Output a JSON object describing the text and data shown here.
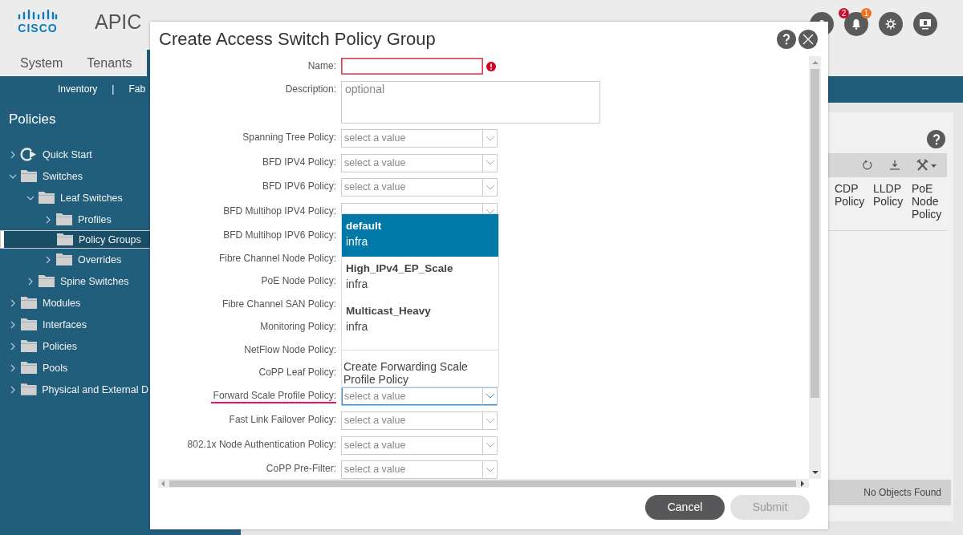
{
  "header": {
    "logo_text": "CISCO",
    "app_name": "APIC",
    "tabs": [
      {
        "label": "System",
        "selected": false
      },
      {
        "label": "Tenants",
        "selected": false
      }
    ],
    "icons": [
      {
        "kind": "user"
      },
      {
        "kind": "bell",
        "badges": [
          {
            "text": "2",
            "color": "#c8102e"
          },
          {
            "text": "1",
            "color": "#f0711f"
          }
        ]
      },
      {
        "kind": "gear"
      },
      {
        "kind": "monitor"
      }
    ]
  },
  "subnav": [
    "Inventory",
    "|",
    "Fab"
  ],
  "sidebar": {
    "title": "Policies",
    "tree": [
      {
        "label": "Quick Start",
        "kind": "quick-start",
        "expandable": true,
        "expanded": false,
        "selected": false
      },
      {
        "label": "Switches",
        "kind": "folder",
        "expandable": true,
        "expanded": true,
        "selected": false,
        "children": [
          {
            "label": "Leaf Switches",
            "kind": "folder",
            "expandable": true,
            "expanded": true,
            "selected": false,
            "children": [
              {
                "label": "Profiles",
                "kind": "folder",
                "expandable": true,
                "expanded": false,
                "selected": false
              },
              {
                "label": "Policy Groups",
                "kind": "folder",
                "expandable": false,
                "selected": true
              },
              {
                "label": "Overrides",
                "kind": "folder",
                "expandable": true,
                "expanded": false,
                "selected": false
              }
            ]
          },
          {
            "label": "Spine Switches",
            "kind": "folder",
            "expandable": true,
            "expanded": false,
            "selected": false
          }
        ]
      },
      {
        "label": "Modules",
        "kind": "folder",
        "expandable": true,
        "expanded": false,
        "selected": false
      },
      {
        "label": "Interfaces",
        "kind": "folder",
        "expandable": true,
        "expanded": false,
        "selected": false
      },
      {
        "label": "Policies",
        "kind": "folder",
        "expandable": true,
        "expanded": false,
        "selected": false
      },
      {
        "label": "Pools",
        "kind": "folder",
        "expandable": true,
        "expanded": false,
        "selected": false
      },
      {
        "label": "Physical and External D",
        "kind": "folder",
        "expandable": true,
        "expanded": false,
        "selected": false
      }
    ]
  },
  "panel": {
    "columns": [
      "CDP Policy",
      "LLDP Policy",
      "PoE Node Policy"
    ],
    "status": "No Objects Found"
  },
  "dialog": {
    "title": "Create Access Switch Policy Group",
    "fields": [
      {
        "label": "Name:",
        "kind": "text",
        "error": true,
        "focused": false,
        "underlined": false
      },
      {
        "label": "Description:",
        "kind": "textarea",
        "placeholder": "optional",
        "error": false,
        "focused": false,
        "underlined": false
      },
      {
        "label": "Spanning Tree Policy:",
        "kind": "select",
        "placeholder": "select a value",
        "error": false,
        "focused": false,
        "underlined": false
      },
      {
        "label": "BFD IPV4 Policy:",
        "kind": "select",
        "placeholder": "select a value",
        "error": false,
        "focused": false,
        "underlined": false
      },
      {
        "label": "BFD IPV6 Policy:",
        "kind": "select",
        "placeholder": "select a value",
        "error": false,
        "focused": false,
        "underlined": false
      },
      {
        "label": "BFD Multihop IPV4 Policy:",
        "kind": "select",
        "box_visible": true,
        "error": false,
        "focused": false,
        "underlined": false
      },
      {
        "label": "BFD Multihop IPV6 Policy:",
        "kind": "select",
        "underlined": false
      },
      {
        "label": "Fibre Channel Node Policy:",
        "kind": "select",
        "underlined": false
      },
      {
        "label": "PoE Node Policy:",
        "kind": "select",
        "underlined": false
      },
      {
        "label": "Fibre Channel SAN Policy:",
        "kind": "select",
        "underlined": false
      },
      {
        "label": "Monitoring Policy:",
        "kind": "select",
        "underlined": false
      },
      {
        "label": "NetFlow Node Policy:",
        "kind": "select",
        "underlined": false
      },
      {
        "label": "CoPP Leaf Policy:",
        "kind": "select",
        "underlined": false
      },
      {
        "label": "Forward Scale Profile Policy:",
        "kind": "select",
        "placeholder": "select a value",
        "error": false,
        "focused": true,
        "underlined": true
      },
      {
        "label": "Fast Link Failover Policy:",
        "kind": "select",
        "placeholder": "select a value",
        "error": false,
        "focused": false,
        "underlined": false
      },
      {
        "label": "802.1x Node Authentication Policy:",
        "kind": "select",
        "placeholder": "select a value",
        "error": false,
        "focused": false,
        "underlined": false
      },
      {
        "label": "CoPP Pre-Filter:",
        "kind": "select",
        "placeholder": "select a value",
        "error": false,
        "focused": false,
        "underlined": false
      }
    ],
    "dropdown": {
      "options": [
        {
          "name": "default",
          "tenant": "infra",
          "selected": true
        },
        {
          "name": "High_IPv4_EP_Scale",
          "tenant": "infra",
          "selected": false
        },
        {
          "name": "Multicast_Heavy",
          "tenant": "infra",
          "selected": false
        }
      ],
      "action": "Create Forwarding Scale Profile Policy"
    },
    "buttons": [
      {
        "label": "Cancel",
        "disabled": false
      },
      {
        "label": "Submit",
        "disabled": true
      }
    ]
  }
}
